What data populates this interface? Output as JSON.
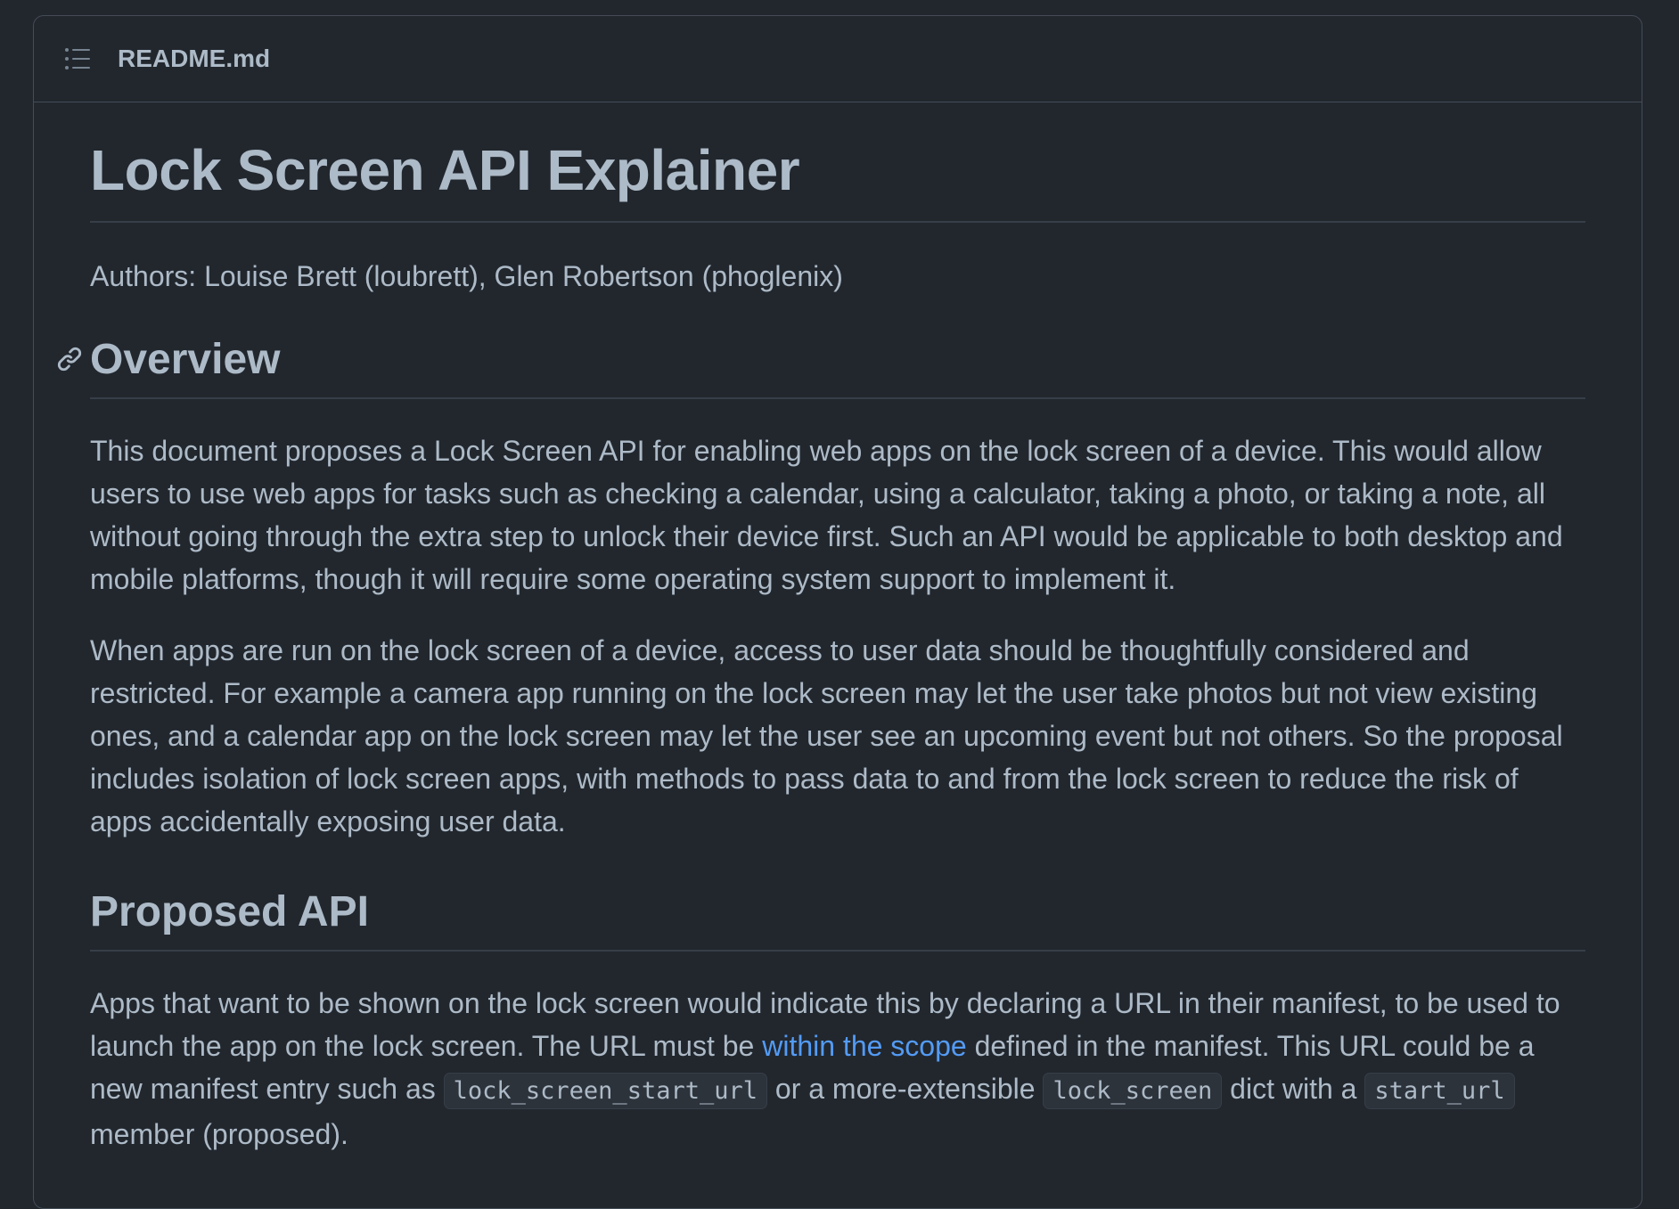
{
  "header": {
    "file_name": "README.md",
    "toc_icon": "list-unordered-icon"
  },
  "article": {
    "title": "Lock Screen API Explainer",
    "authors": "Authors: Louise Brett (loubrett), Glen Robertson (phoglenix)",
    "overview": {
      "heading": "Overview",
      "anchor_icon": "link-icon",
      "p1": "This document proposes a Lock Screen API for enabling web apps on the lock screen of a device. This would allow users to use web apps for tasks such as checking a calendar, using a calculator, taking a photo, or taking a note, all without going through the extra step to unlock their device first. Such an API would be applicable to both desktop and mobile platforms, though it will require some operating system support to implement it.",
      "p2": "When apps are run on the lock screen of a device, access to user data should be thoughtfully considered and restricted. For example a camera app running on the lock screen may let the user take photos but not view existing ones, and a calendar app on the lock screen may let the user see an upcoming event but not others. So the proposal includes isolation of lock screen apps, with methods to pass data to and from the lock screen to reduce the risk of apps accidentally exposing user data."
    },
    "proposed": {
      "heading": "Proposed API",
      "p_part1": "Apps that want to be shown on the lock screen would indicate this by declaring a URL in their manifest, to be used to launch the app on the lock screen. The URL must be ",
      "link_text": "within the scope",
      "p_part2": " defined in the manifest. This URL could be a new manifest entry such as ",
      "code1": "lock_screen_start_url",
      "p_part3": " or a more-extensible ",
      "code2": "lock_screen",
      "p_part4": " dict with a ",
      "code3": "start_url",
      "p_part5": " member (proposed)."
    }
  },
  "colors": {
    "background": "#22272e",
    "text": "#adbac7",
    "border": "#444c56",
    "link": "#539bf5",
    "code_bg": "#2d333b"
  }
}
